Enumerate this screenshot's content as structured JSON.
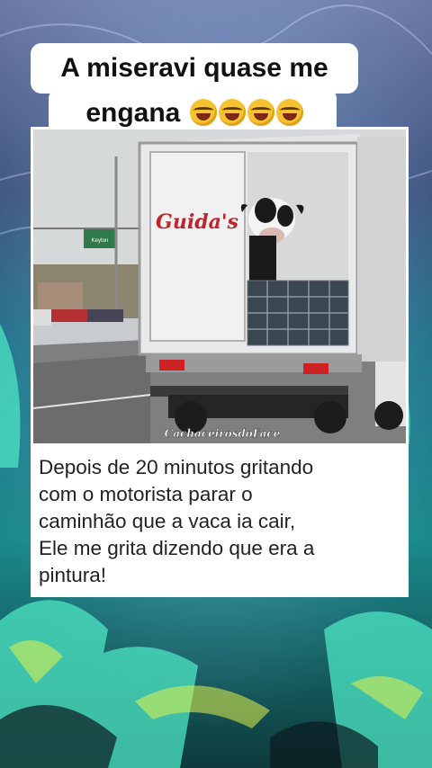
{
  "caption": {
    "line1": "A miseravi quase me",
    "line2": "engana",
    "emoji_icon": "rolling-on-floor-laughing-emoji",
    "emoji_count": 4
  },
  "card": {
    "image": {
      "truck_brand": "Guida's",
      "road_sign": "Keyton",
      "watermark": "CachaceirosdoFace"
    },
    "text_lines": [
      "Depois de 20 minutos gritando",
      "com o motorista parar o",
      "caminhão que a vaca ia cair,",
      "Ele me grita dizendo que era a",
      "pintura!"
    ]
  },
  "colors": {
    "background": "#163a4e",
    "glow": "#36e0c8",
    "caption_bg": "#ffffff",
    "brand_red": "#c0242c"
  }
}
